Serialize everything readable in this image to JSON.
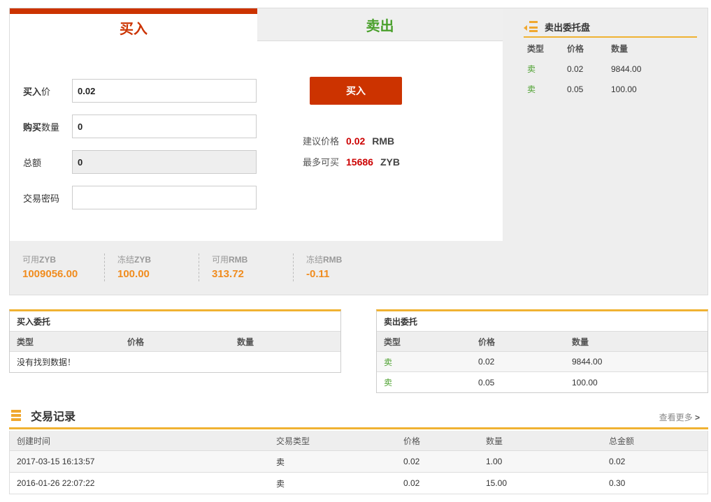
{
  "tabs": {
    "buy": "买入",
    "sell": "卖出"
  },
  "form": {
    "price_label_bold": "买入",
    "price_label_rest": "价",
    "price_value": "0.02",
    "qty_label_bold": "购买",
    "qty_label_rest": "数量",
    "qty_value": "0",
    "total_label": "总额",
    "total_value": "0",
    "password_label": "交易密码",
    "password_value": ""
  },
  "buy_button": "买入",
  "suggest": {
    "label": "建议价格",
    "value": "0.02",
    "unit": "RMB"
  },
  "max_buy": {
    "label": "最多可买",
    "value": "15686",
    "unit": "ZYB"
  },
  "balances": [
    {
      "prefix": "可用",
      "code": "ZYB",
      "value": "1009056.00"
    },
    {
      "prefix": "冻结",
      "code": "ZYB",
      "value": "100.00"
    },
    {
      "prefix": "可用",
      "code": "RMB",
      "value": "313.72"
    },
    {
      "prefix": "冻结",
      "code": "RMB",
      "value": "-0.11"
    }
  ],
  "order_book": {
    "title": "卖出委托盘",
    "headers": [
      "类型",
      "价格",
      "数量"
    ],
    "rows": [
      {
        "type": "卖",
        "price": "0.02",
        "qty": "9844.00"
      },
      {
        "type": "卖",
        "price": "0.05",
        "qty": "100.00"
      }
    ]
  },
  "buy_orders": {
    "title": "买入委托",
    "headers": [
      "类型",
      "价格",
      "数量"
    ],
    "empty": "没有找到数据！"
  },
  "sell_orders": {
    "title": "卖出委托",
    "headers": [
      "类型",
      "价格",
      "数量"
    ],
    "rows": [
      {
        "type": "卖",
        "price": "0.02",
        "qty": "9844.00"
      },
      {
        "type": "卖",
        "price": "0.05",
        "qty": "100.00"
      }
    ]
  },
  "records": {
    "title": "交易记录",
    "view_more": "查看更多",
    "view_more_arrow": ">",
    "headers": [
      "创建时间",
      "交易类型",
      "价格",
      "数量",
      "总金额"
    ],
    "rows": [
      {
        "time": "2017-03-15 16:13:57",
        "type": "卖",
        "price": "0.02",
        "qty": "1.00",
        "total": "0.02"
      },
      {
        "time": "2016-01-26 22:07:22",
        "type": "卖",
        "price": "0.02",
        "qty": "15.00",
        "total": "0.30"
      }
    ]
  },
  "colors": {
    "buy": "#cc3300",
    "sell": "#4aa02c",
    "accent": "#f0b232",
    "balance": "#f08c1e",
    "highlight": "#cc0000"
  }
}
